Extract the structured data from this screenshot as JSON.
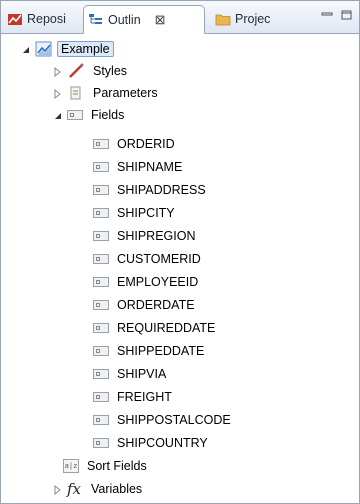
{
  "tabs": [
    {
      "label": "Reposi",
      "icon": "repository-icon"
    },
    {
      "label": "Outlin",
      "icon": "outline-icon",
      "close": "⊠"
    },
    {
      "label": "Projec",
      "icon": "project-folder-icon"
    }
  ],
  "tree": {
    "root": "Example",
    "styles": "Styles",
    "parameters": "Parameters",
    "fields_label": "Fields",
    "fields": [
      "ORDERID",
      "SHIPNAME",
      "SHIPADDRESS",
      "SHIPCITY",
      "SHIPREGION",
      "CUSTOMERID",
      "EMPLOYEEID",
      "ORDERDATE",
      "REQUIREDDATE",
      "SHIPPEDDATE",
      "SHIPVIA",
      "FREIGHT",
      "SHIPPOSTALCODE",
      "SHIPCOUNTRY"
    ],
    "sort_fields": "Sort Fields",
    "variables": "Variables"
  },
  "icons": {
    "variables_glyph": "fx",
    "sort_glyph": "a|z"
  },
  "colors": {
    "accent": "#7da2ce",
    "selection": "#dce9f8"
  }
}
